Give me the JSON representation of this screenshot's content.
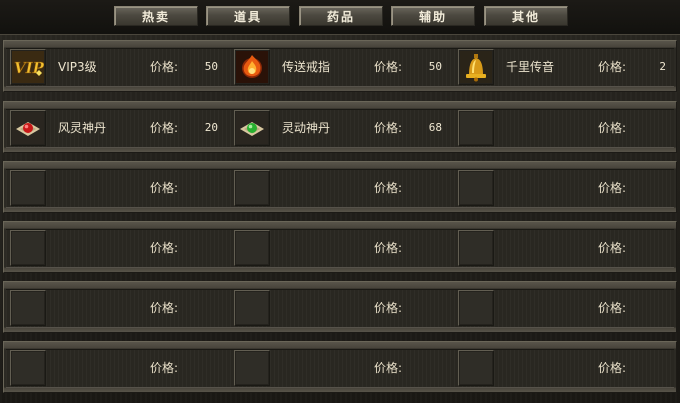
{
  "tabs": [
    {
      "label": "热卖"
    },
    {
      "label": "道具"
    },
    {
      "label": "药品"
    },
    {
      "label": "辅助"
    },
    {
      "label": "其他"
    }
  ],
  "price_label": "价格:",
  "rows": [
    [
      {
        "name": "VIP3级",
        "price": "50",
        "icon": "vip-badge-icon"
      },
      {
        "name": "传送戒指",
        "price": "50",
        "icon": "flame-ring-icon"
      },
      {
        "name": "千里传音",
        "price": "2",
        "icon": "golden-bell-icon"
      }
    ],
    [
      {
        "name": "风灵神丹",
        "price": "20",
        "icon": "red-gem-pill-icon"
      },
      {
        "name": "灵动神丹",
        "price": "68",
        "icon": "green-gem-pill-icon"
      },
      {
        "name": "",
        "price": "",
        "icon": ""
      }
    ],
    [
      {
        "name": "",
        "price": "",
        "icon": ""
      },
      {
        "name": "",
        "price": "",
        "icon": ""
      },
      {
        "name": "",
        "price": "",
        "icon": ""
      }
    ],
    [
      {
        "name": "",
        "price": "",
        "icon": ""
      },
      {
        "name": "",
        "price": "",
        "icon": ""
      },
      {
        "name": "",
        "price": "",
        "icon": ""
      }
    ],
    [
      {
        "name": "",
        "price": "",
        "icon": ""
      },
      {
        "name": "",
        "price": "",
        "icon": ""
      },
      {
        "name": "",
        "price": "",
        "icon": ""
      }
    ],
    [
      {
        "name": "",
        "price": "",
        "icon": ""
      },
      {
        "name": "",
        "price": "",
        "icon": ""
      },
      {
        "name": "",
        "price": "",
        "icon": ""
      }
    ]
  ],
  "colors": {
    "vip_gold": "#e8b020",
    "flame": "#e85a10",
    "bell_gold": "#d89a18",
    "red_gem": "#c81818",
    "green_gem": "#28b030"
  }
}
